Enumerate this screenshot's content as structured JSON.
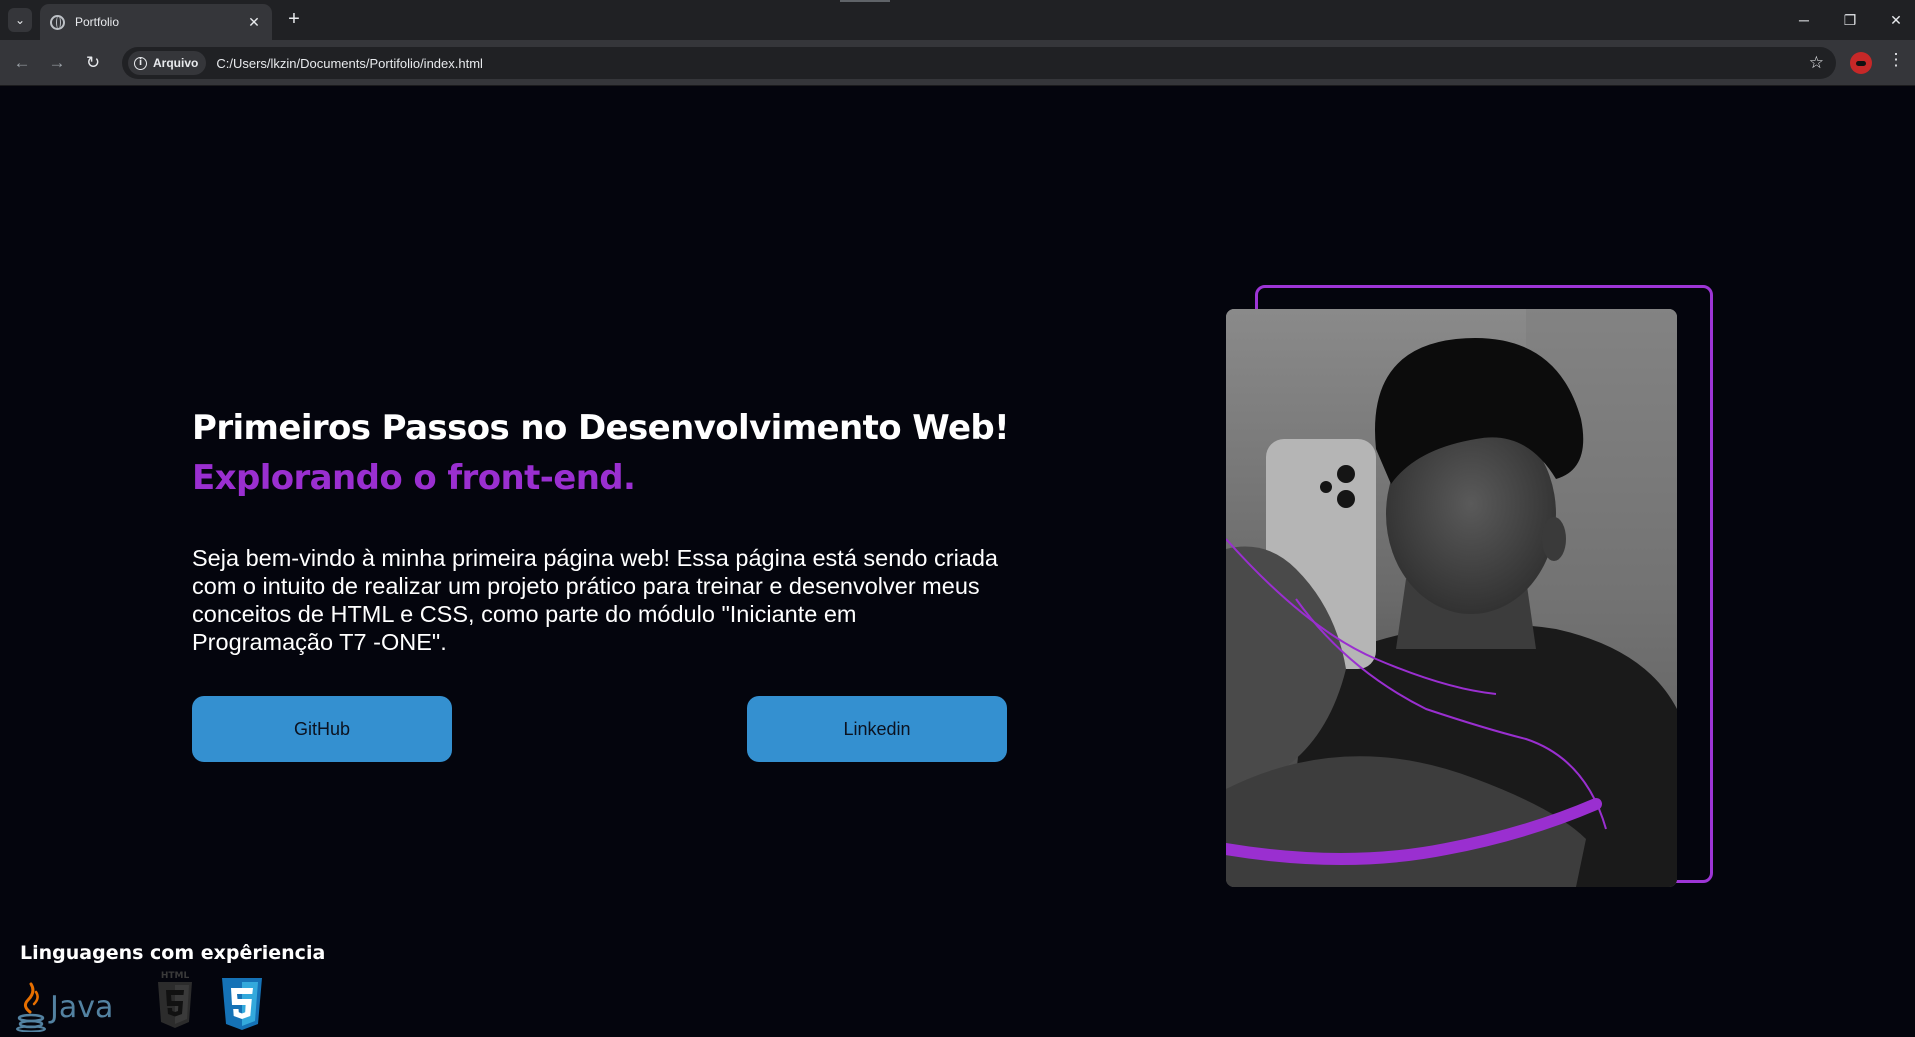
{
  "browser": {
    "tab_title": "Portfolio",
    "site_chip_label": "Arquivo",
    "url": "C:/Users/lkzin/Documents/Portifolio/index.html"
  },
  "hero": {
    "title": "Primeiros Passos no Desenvolvimento Web!",
    "subtitle": "Explorando o front-end.",
    "description": "Seja bem-vindo à minha primeira página web! Essa página está sendo criada com o intuito de realizar um projeto prático para treinar e desenvolver meus conceitos de HTML e CSS, como parte do módulo \"Iniciante em Programação T7 -ONE\".",
    "buttons": {
      "github": "GitHub",
      "linkedin": "Linkedin"
    }
  },
  "skills": {
    "title": "Linguagens com expêriencia",
    "languages": [
      {
        "label": "Java",
        "icon": "java-icon"
      },
      {
        "label": "HTML",
        "icon": "html5-icon"
      },
      {
        "label": "CSS",
        "icon": "css3-icon"
      }
    ]
  },
  "colors": {
    "background": "#04050d",
    "accent_purple": "#9a2fd0",
    "button_blue": "#3490d0",
    "chrome_dark": "#202124",
    "chrome_toolbar": "#35363a"
  }
}
